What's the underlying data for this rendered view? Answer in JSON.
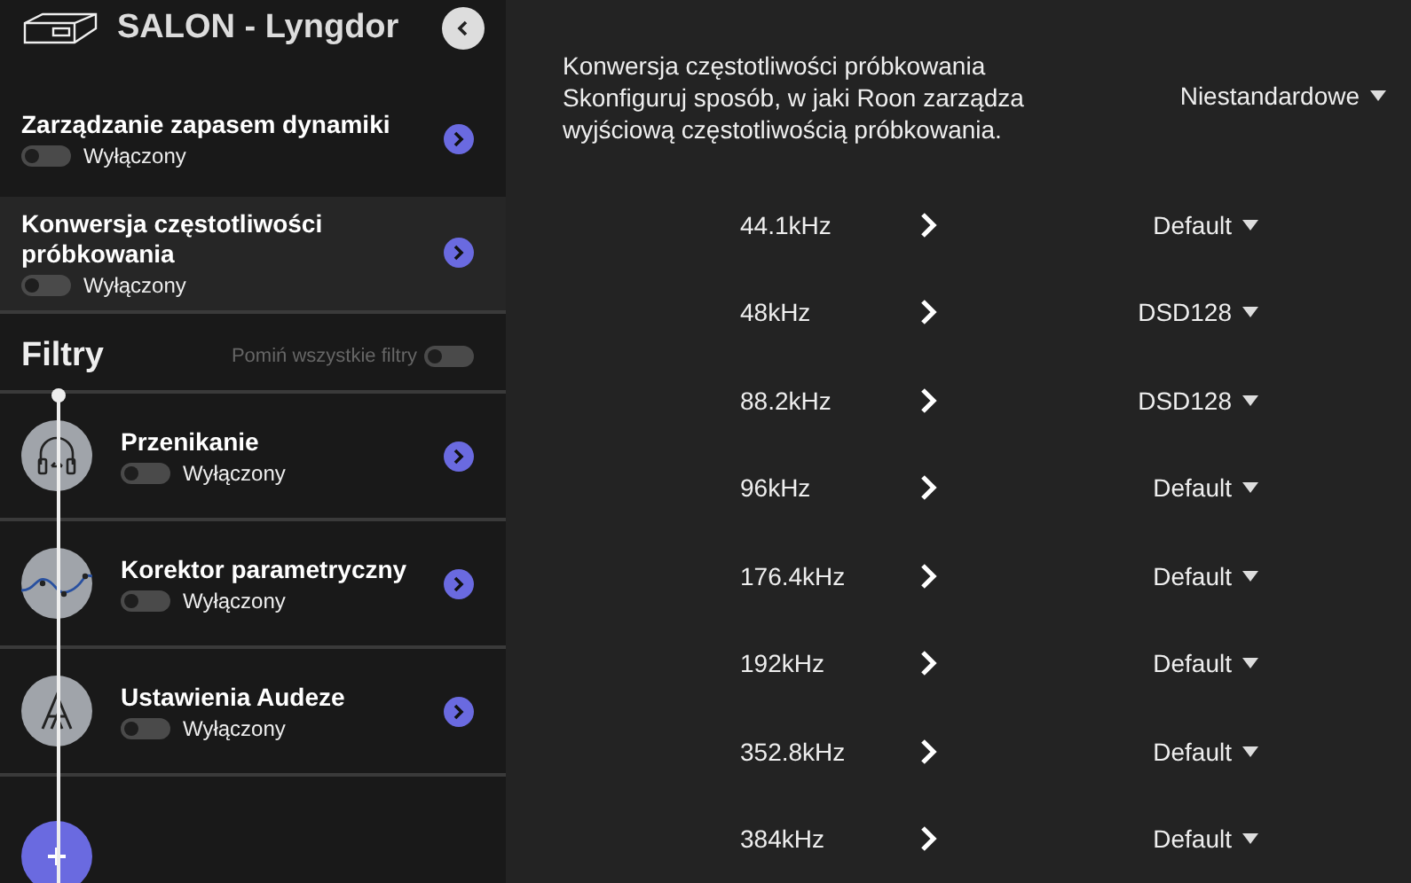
{
  "device": {
    "title": "SALON - Lyngdor"
  },
  "settings": [
    {
      "title": "Zarządzanie zapasem dynamiki",
      "status": "Wyłączony",
      "on": false,
      "selected": false
    },
    {
      "title": "Konwersja częstotliwości próbkowania",
      "status": "Wyłączony",
      "on": false,
      "selected": true
    }
  ],
  "filters": {
    "title": "Filtry",
    "bypass": {
      "label": "Pomiń wszystkie filtry",
      "on": false
    },
    "items": [
      {
        "name": "Przenikanie",
        "status": "Wyłączony",
        "on": false,
        "kind": "crossfeed"
      },
      {
        "name": "Korektor parametryczny",
        "status": "Wyłączony",
        "on": false,
        "kind": "eq"
      },
      {
        "name": "Ustawienia Audeze",
        "status": "Wyłączony",
        "on": false,
        "kind": "audeze"
      }
    ]
  },
  "detail": {
    "title": "Konwersja częstotliwości próbkowania",
    "description": "Skonfiguruj sposób, w jaki Roon zarządza wyjściową częstotliwością próbkowania.",
    "mode": "Niestandardowe"
  },
  "rates": [
    {
      "rate": "44.1kHz",
      "value": "Default"
    },
    {
      "rate": "48kHz",
      "value": "DSD128"
    },
    {
      "rate": "88.2kHz",
      "value": "DSD128"
    },
    {
      "rate": "96kHz",
      "value": "Default"
    },
    {
      "rate": "176.4kHz",
      "value": "Default"
    },
    {
      "rate": "192kHz",
      "value": "Default"
    },
    {
      "rate": "352.8kHz",
      "value": "Default"
    },
    {
      "rate": "384kHz",
      "value": "Default"
    }
  ]
}
